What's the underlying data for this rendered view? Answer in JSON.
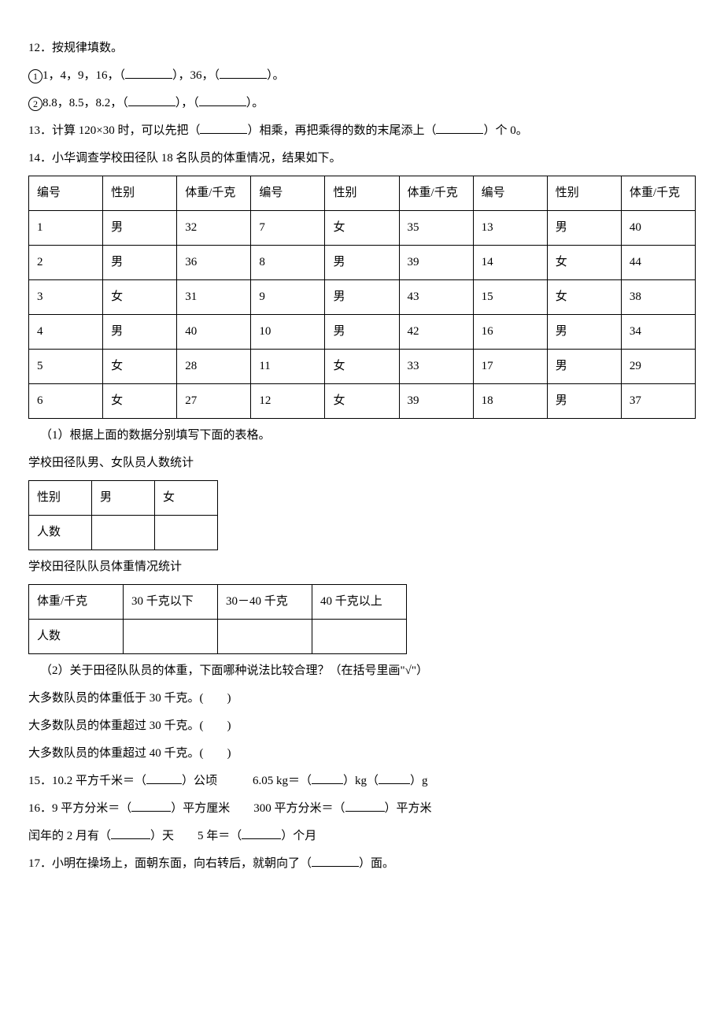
{
  "q12": {
    "title": "12．按规律填数。",
    "l1a": "1，4，9，16，（",
    "l1b": "），36，（",
    "l1c": "）。",
    "l2a": "8.8，8.5，8.2，（",
    "l2b": "），（",
    "l2c": "）。",
    "circle1": "1",
    "circle2": "2"
  },
  "q13": {
    "a": "13．计算 120×30 时，可以先把（",
    "b": "）相乘，再把乘得的数的末尾添上（",
    "c": "）个 0。"
  },
  "q14": {
    "title": "14．小华调查学校田径队 18 名队员的体重情况，结果如下。",
    "headers": [
      "编号",
      "性别",
      "体重/千克",
      "编号",
      "性别",
      "体重/千克",
      "编号",
      "性别",
      "体重/千克"
    ],
    "rows": [
      [
        "1",
        "男",
        "32",
        "7",
        "女",
        "35",
        "13",
        "男",
        "40"
      ],
      [
        "2",
        "男",
        "36",
        "8",
        "男",
        "39",
        "14",
        "女",
        "44"
      ],
      [
        "3",
        "女",
        "31",
        "9",
        "男",
        "43",
        "15",
        "女",
        "38"
      ],
      [
        "4",
        "男",
        "40",
        "10",
        "男",
        "42",
        "16",
        "男",
        "34"
      ],
      [
        "5",
        "女",
        "28",
        "11",
        "女",
        "33",
        "17",
        "男",
        "29"
      ],
      [
        "6",
        "女",
        "27",
        "12",
        "女",
        "39",
        "18",
        "男",
        "37"
      ]
    ],
    "sub1": "（1）根据上面的数据分别填写下面的表格。",
    "gender_caption": "学校田径队男、女队员人数统计",
    "gender_headers": [
      "性别",
      "男",
      "女"
    ],
    "gender_row": "人数",
    "weight_caption": "学校田径队队员体重情况统计",
    "weight_headers": [
      "体重/千克",
      "30 千克以下",
      "30－40 千克",
      "40 千克以上"
    ],
    "weight_row": "人数",
    "sub2": "（2）关于田径队队员的体重，下面哪种说法比较合理？（在括号里画\"√\"）",
    "opt1": "大多数队员的体重低于 30 千克。(　　)",
    "opt2": "大多数队员的体重超过 30 千克。(　　)",
    "opt3": "大多数队员的体重超过 40 千克。(　　)"
  },
  "q15": {
    "a": "15．10.2 平方千米＝（",
    "b": "）公顷　　　6.05 kg＝（",
    "c": "）kg（",
    "d": "）g"
  },
  "q16": {
    "l1a": "16．9 平方分米＝（",
    "l1b": "）平方厘米　　300 平方分米＝（",
    "l1c": "）平方米",
    "l2a": "闰年的 2 月有（",
    "l2b": "）天　　5 年＝（",
    "l2c": "）个月"
  },
  "q17": {
    "a": "17．小明在操场上，面朝东面，向右转后，就朝向了（",
    "b": "）面。"
  },
  "chart_data": {
    "type": "table",
    "title": "学校田径队 18 名队员的体重",
    "columns": [
      "编号",
      "性别",
      "体重/千克"
    ],
    "rows": [
      [
        1,
        "男",
        32
      ],
      [
        2,
        "男",
        36
      ],
      [
        3,
        "女",
        31
      ],
      [
        4,
        "男",
        40
      ],
      [
        5,
        "女",
        28
      ],
      [
        6,
        "女",
        27
      ],
      [
        7,
        "女",
        35
      ],
      [
        8,
        "男",
        39
      ],
      [
        9,
        "男",
        43
      ],
      [
        10,
        "男",
        42
      ],
      [
        11,
        "女",
        33
      ],
      [
        12,
        "女",
        39
      ],
      [
        13,
        "男",
        40
      ],
      [
        14,
        "女",
        44
      ],
      [
        15,
        "女",
        38
      ],
      [
        16,
        "男",
        34
      ],
      [
        17,
        "男",
        29
      ],
      [
        18,
        "男",
        37
      ]
    ]
  }
}
